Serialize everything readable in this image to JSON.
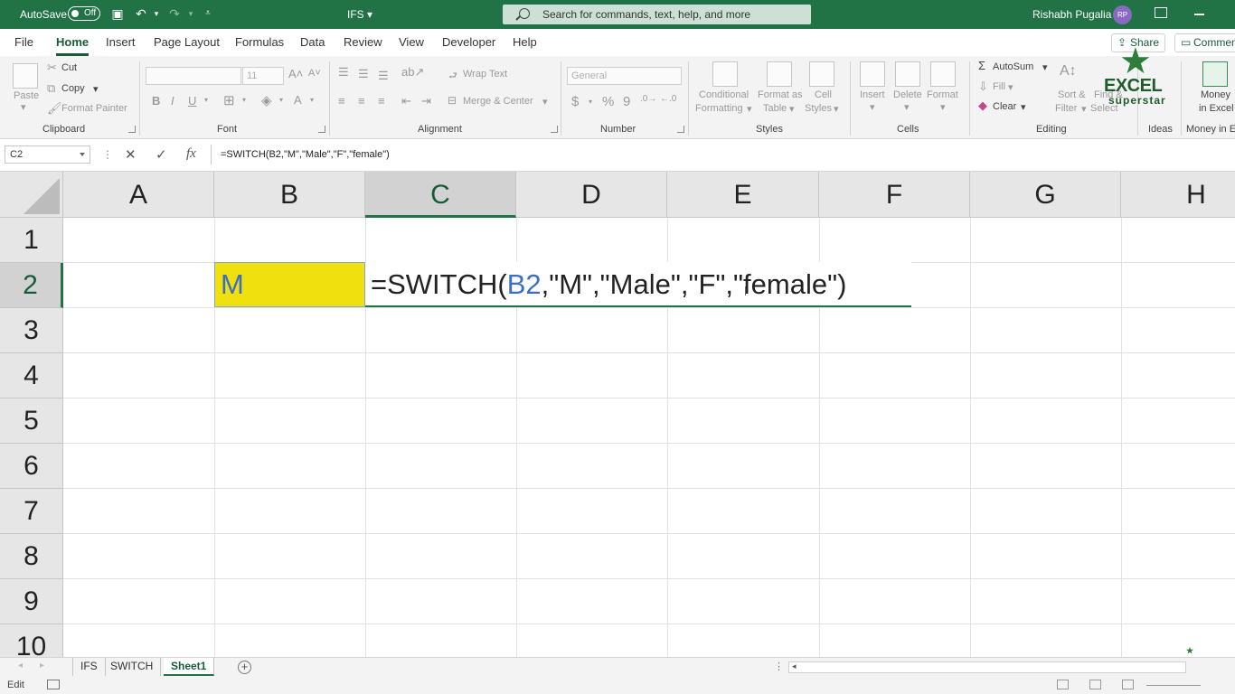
{
  "titlebar": {
    "autosave_label": "AutoSave",
    "autosave_state": "Off",
    "doc_title": "IFS",
    "search_placeholder": "Search for commands, text, help, and more",
    "user_name": "Rishabh Pugalia",
    "user_initials": "RP"
  },
  "menu": {
    "tabs": [
      "File",
      "Home",
      "Insert",
      "Page Layout",
      "Formulas",
      "Data",
      "Review",
      "View",
      "Developer",
      "Help"
    ],
    "active": "Home",
    "share": "Share",
    "comments": "Comments"
  },
  "ribbon": {
    "clipboard": {
      "label": "Clipboard",
      "paste": "Paste",
      "cut": "Cut",
      "copy": "Copy",
      "format_painter": "Format Painter"
    },
    "font": {
      "label": "Font",
      "font_size": "11"
    },
    "alignment": {
      "label": "Alignment",
      "wrap_text": "Wrap Text",
      "merge_center": "Merge & Center"
    },
    "number": {
      "label": "Number",
      "format": "General"
    },
    "styles": {
      "label": "Styles",
      "conditional": "Conditional",
      "formatting": "Formatting",
      "format_as": "Format as",
      "table": "Table",
      "cell": "Cell",
      "styles": "Styles"
    },
    "cells": {
      "label": "Cells",
      "insert": "Insert",
      "delete": "Delete",
      "format": "Format"
    },
    "editing": {
      "label": "Editing",
      "autosum": "AutoSum",
      "fill": "Fill",
      "clear": "Clear",
      "sort": "Sort &",
      "filter": "Filter",
      "find": "Find &",
      "select": "Select"
    },
    "ideas": {
      "label": "Ideas"
    },
    "money": {
      "label": "Money in Excel",
      "line1": "Money",
      "line2": "in Excel"
    }
  },
  "logo": {
    "excel": "EXCEL",
    "superstar": "superstar"
  },
  "formula_bar": {
    "name_box": "C2",
    "formula": "=SWITCH(B2,\"M\",\"Male\",\"F\",\"female\")"
  },
  "grid": {
    "columns": [
      "A",
      "B",
      "C",
      "D",
      "E",
      "F",
      "G",
      "H"
    ],
    "rows": [
      "1",
      "2",
      "3",
      "4",
      "5",
      "6",
      "7",
      "8",
      "9",
      "10"
    ],
    "selected_column": "C",
    "selected_row": "2",
    "b2": "M",
    "c2_prefix": "=SWITCH(",
    "c2_ref": "B2",
    "c2_suffix": ",\"M\",\"Male\",\"F\",\"female\")",
    "b2_fill": "#f0e00d",
    "ref_color": "#3b6fc4"
  },
  "sheets": {
    "tabs": [
      "IFS",
      "SWITCH",
      "Sheet1"
    ],
    "active": "Sheet1"
  },
  "status": {
    "mode": "Edit"
  },
  "colors": {
    "brand": "#217346",
    "accent_dark": "#185c37"
  }
}
